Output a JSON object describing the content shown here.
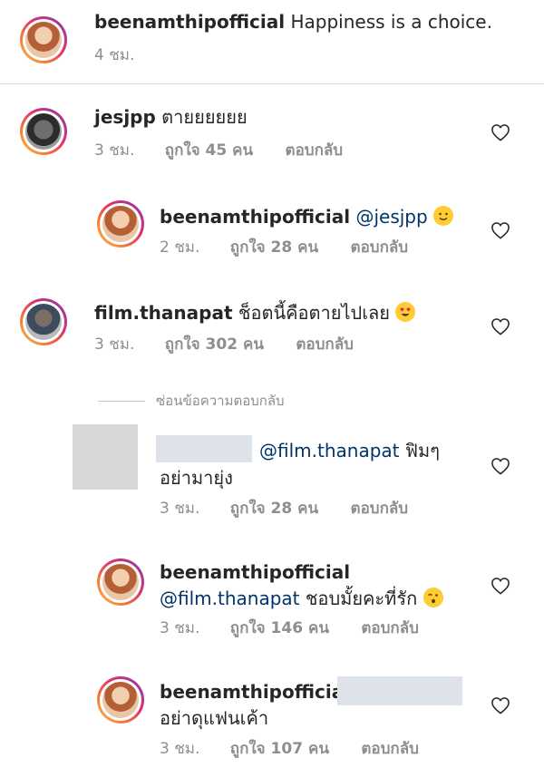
{
  "caption": {
    "username": "beenamthipofficial",
    "text": "Happiness is a choice.",
    "time": "4 ชม."
  },
  "comments": [
    {
      "username": "jesjpp",
      "text": "ตายยยยยย",
      "time": "3 ชม.",
      "likes": "ถูกใจ 45 คน",
      "reply": "ตอบกลับ"
    },
    {
      "username": "beenamthipofficial",
      "mention": "@jesjpp",
      "emoji": "slightly-smiling-face-emoji",
      "time": "2 ชม.",
      "likes": "ถูกใจ 28 คน",
      "reply": "ตอบกลับ"
    },
    {
      "username": "film.thanapat",
      "text": "ช็อตนี้คือตายไปเลย",
      "emoji": "heart-eyes-emoji",
      "time": "3 ชม.",
      "likes": "ถูกใจ 302 คน",
      "reply": "ตอบกลับ"
    },
    {
      "mention": "@film.thanapat",
      "text_line1": "ฟิมๆ",
      "text_line2": "อย่ามายุ่ง",
      "time": "3 ชม.",
      "likes": "ถูกใจ 28 คน",
      "reply": "ตอบกลับ"
    },
    {
      "username": "beenamthipofficial",
      "mention": "@film.thanapat",
      "text": "ชอบมั้ยคะที่รัก",
      "emoji": "kissing-face-emoji",
      "time": "3 ชม.",
      "likes": "ถูกใจ 146 คน",
      "reply": "ตอบกลับ"
    },
    {
      "username": "beenamthipofficial",
      "text_line2": "อย่าดุแฟนเค้า",
      "time": "3 ชม.",
      "likes": "ถูกใจ 107 คน",
      "reply": "ตอบกลับ"
    }
  ],
  "hide_replies": "ซ่อนข้อความตอบกลับ",
  "colors": {
    "text": "#262626",
    "meta": "#8e8e8e",
    "mention": "#003569",
    "divider": "#dbdbdb"
  },
  "icons": [
    "heart-outline-icon"
  ]
}
